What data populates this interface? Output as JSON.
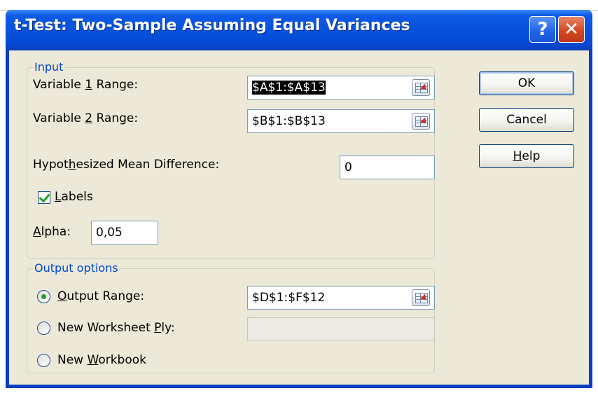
{
  "window": {
    "title": "t-Test: Two-Sample Assuming Equal Variances",
    "help_button_glyph": "?",
    "close_button_glyph": "✕"
  },
  "input_group": {
    "legend": "Input",
    "variable1": {
      "label_pre": "Variable ",
      "label_key": "1",
      "label_post": " Range:",
      "value": "$A$1:$A$13"
    },
    "variable2": {
      "label_pre": "Variable ",
      "label_key": "2",
      "label_post": " Range:",
      "value": "$B$1:$B$13"
    },
    "hypothesized": {
      "label_pre": "Hypot",
      "label_key": "h",
      "label_post": "esized Mean Difference:",
      "value": "0"
    },
    "labels_checkbox": {
      "label_pre": "",
      "label_key": "L",
      "label_post": "abels",
      "checked": true
    },
    "alpha": {
      "label_pre": "",
      "label_key": "A",
      "label_post": "lpha:",
      "value": "0,05"
    }
  },
  "output_group": {
    "legend": "Output options",
    "output_range": {
      "label_pre": "",
      "label_key": "O",
      "label_post": "utput Range:",
      "value": "$D$1:$F$12",
      "selected": true
    },
    "new_worksheet": {
      "label_pre": "New Worksheet ",
      "label_key": "P",
      "label_post": "ly:",
      "value": "",
      "selected": false
    },
    "new_workbook": {
      "label_pre": "New ",
      "label_key": "W",
      "label_post": "orkbook",
      "selected": false
    }
  },
  "buttons": {
    "ok": "OK",
    "cancel": "Cancel",
    "help_pre": "",
    "help_key": "H",
    "help_post": "elp"
  },
  "colors": {
    "title_bar": "#0752dc",
    "client_bg": "#ece9d8",
    "group_legend": "#0046d5",
    "check_mark": "#21a121"
  }
}
